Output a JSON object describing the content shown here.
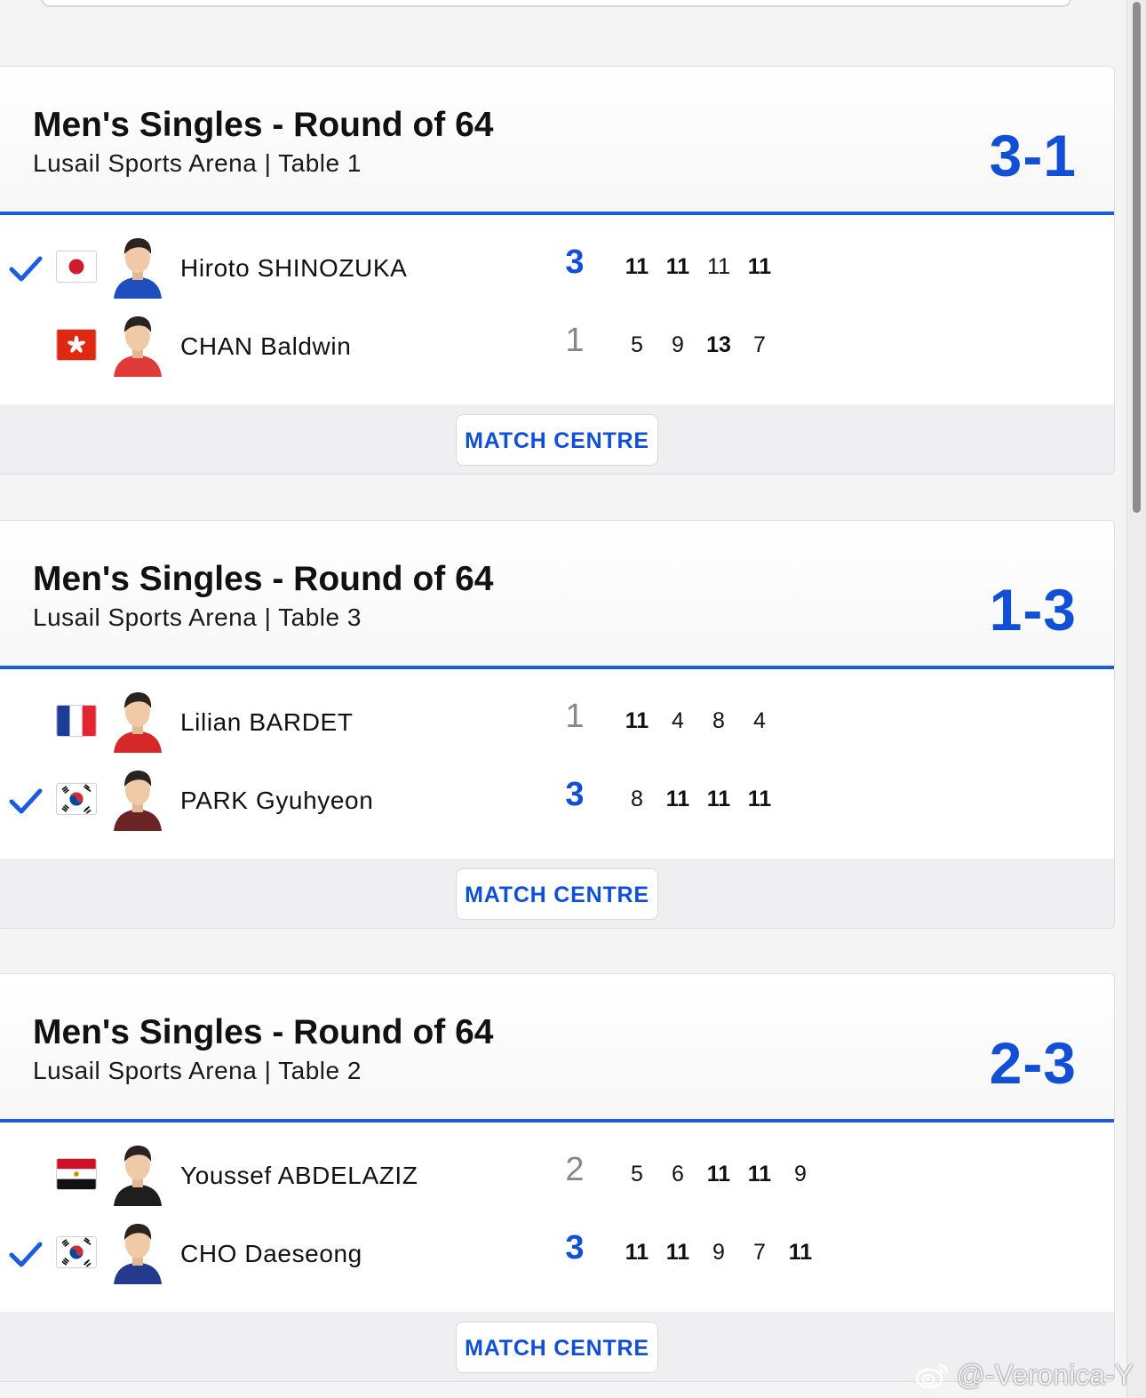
{
  "matches": [
    {
      "event": "Men's Singles - Round of 64",
      "venue": "Lusail Sports Arena | Table 1",
      "score": "3-1",
      "button_label": "MATCH CENTRE",
      "players": [
        {
          "name": "Hiroto SHINOZUKA",
          "flag_icon": "japan-flag-icon",
          "winner": true,
          "sets": "3",
          "games": [
            {
              "v": "11",
              "won": true
            },
            {
              "v": "11",
              "won": true
            },
            {
              "v": "11",
              "won": false
            },
            {
              "v": "11",
              "won": true
            }
          ],
          "shirt_color": "#1f4fbf"
        },
        {
          "name": "CHAN Baldwin",
          "flag_icon": "hong-kong-flag-icon",
          "winner": false,
          "sets": "1",
          "games": [
            {
              "v": "5",
              "won": false
            },
            {
              "v": "9",
              "won": false
            },
            {
              "v": "13",
              "won": true
            },
            {
              "v": "7",
              "won": false
            }
          ],
          "shirt_color": "#e03a3a"
        }
      ]
    },
    {
      "event": "Men's Singles - Round of 64",
      "venue": "Lusail Sports Arena | Table 3",
      "score": "1-3",
      "button_label": "MATCH CENTRE",
      "players": [
        {
          "name": "Lilian BARDET",
          "flag_icon": "france-flag-icon",
          "winner": false,
          "sets": "1",
          "games": [
            {
              "v": "11",
              "won": true
            },
            {
              "v": "4",
              "won": false
            },
            {
              "v": "8",
              "won": false
            },
            {
              "v": "4",
              "won": false
            }
          ],
          "shirt_color": "#d62828"
        },
        {
          "name": "PARK Gyuhyeon",
          "flag_icon": "south-korea-flag-icon",
          "winner": true,
          "sets": "3",
          "games": [
            {
              "v": "8",
              "won": false
            },
            {
              "v": "11",
              "won": true
            },
            {
              "v": "11",
              "won": true
            },
            {
              "v": "11",
              "won": true
            }
          ],
          "shirt_color": "#6b2424"
        }
      ]
    },
    {
      "event": "Men's Singles - Round of 64",
      "venue": "Lusail Sports Arena | Table 2",
      "score": "2-3",
      "button_label": "MATCH CENTRE",
      "players": [
        {
          "name": "Youssef ABDELAZIZ",
          "flag_icon": "egypt-flag-icon",
          "winner": false,
          "sets": "2",
          "games": [
            {
              "v": "5",
              "won": false
            },
            {
              "v": "6",
              "won": false
            },
            {
              "v": "11",
              "won": true
            },
            {
              "v": "11",
              "won": true
            },
            {
              "v": "9",
              "won": false
            }
          ],
          "shirt_color": "#1e1e1e"
        },
        {
          "name": "CHO Daeseong",
          "flag_icon": "south-korea-flag-icon",
          "winner": true,
          "sets": "3",
          "games": [
            {
              "v": "11",
              "won": true
            },
            {
              "v": "11",
              "won": true
            },
            {
              "v": "9",
              "won": false
            },
            {
              "v": "7",
              "won": false
            },
            {
              "v": "11",
              "won": true
            }
          ],
          "shirt_color": "#243a8f"
        }
      ]
    }
  ],
  "watermark": "@-Veronica-Y",
  "colors": {
    "accent": "#1150d6",
    "divider": "#1a5ce0",
    "loser_sets": "#888888"
  }
}
